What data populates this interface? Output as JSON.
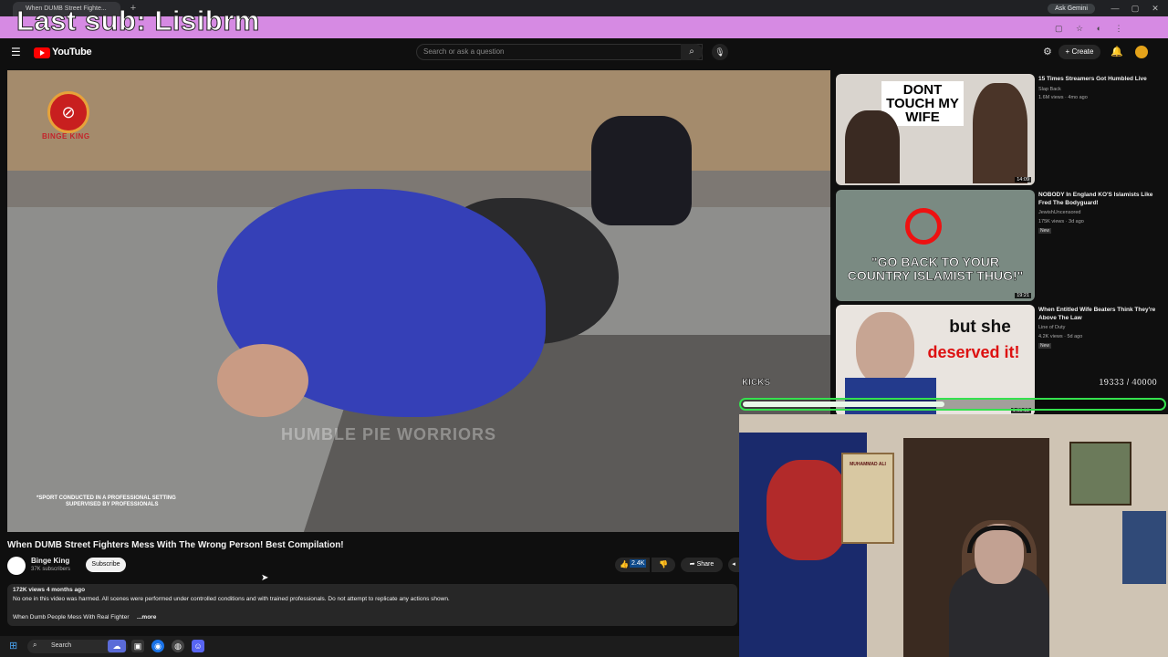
{
  "browser": {
    "tab_title": "When DUMB Street Fighte...",
    "ask_gemini": "Ask Gemini",
    "window_controls": [
      "—",
      "▢",
      "✕"
    ]
  },
  "overlay": {
    "last_sub_text": "Last sub: Lisibrm",
    "kicks_label": "KICKS",
    "kicks_count": "19333 / 40000",
    "kicks_progress": 0.48
  },
  "header": {
    "logo_text": "YouTube",
    "search_placeholder": "Search or ask a question",
    "create_label": "Create"
  },
  "video": {
    "brand_label": "BINGE KING",
    "watermark": "HUMBLE PIE WORRIORS",
    "disclaimer_line1": "*SPORT CONDUCTED IN A PROFESSIONAL SETTING",
    "disclaimer_line2": "SUPERVISED BY PROFESSIONALS",
    "title": "When DUMB Street Fighters Mess With The Wrong Person! Best Compilation!",
    "channel_name": "Binge King",
    "channel_subs": "37K subscribers",
    "subscribe_label": "Subscribe",
    "like_count": "2.4K",
    "share_label": "Share",
    "description_meta": "172K views  4 months ago",
    "description_line1": "No one in this video was harmed. All scenes were performed under controlled conditions and with trained professionals. Do not attempt to replicate any actions shown.",
    "description_line2": "When Dumb People Mess With Real Fighter",
    "description_more": "...more"
  },
  "recommendations": [
    {
      "title": "15 Times Streamers Got Humbled Live",
      "channel": "Slap Back",
      "meta": "1.6M views · 4mo ago",
      "duration": "14:09",
      "thumb_text": "DONT TOUCH MY WIFE",
      "badge": ""
    },
    {
      "title": "NOBODY In England KO'S Islamists Like Fred The Bodyguard!",
      "channel": "JewishUncensored",
      "meta": "175K views · 3d ago",
      "duration": "19:21",
      "thumb_text": "\"GO BACK TO YOUR COUNTRY ISLAMIST THUG!\"",
      "badge": "New"
    },
    {
      "title": "When Entitled Wife Beaters Think They're Above The Law",
      "channel": "Line of Duty",
      "meta": "4.2K views · 5d ago",
      "duration": "1:03:13",
      "thumb_text_a": "but she",
      "thumb_text_b": "deserved it!",
      "badge": "New"
    }
  ],
  "webcam": {
    "poster_text": "MUHAMMAD ALI"
  },
  "taskbar": {
    "search_label": "Search"
  },
  "colors": {
    "banner": "#d68ae3",
    "kicks_bar": "#35e14e",
    "youtube_red": "#ff0000",
    "like_highlight": "#0f4a8a"
  }
}
